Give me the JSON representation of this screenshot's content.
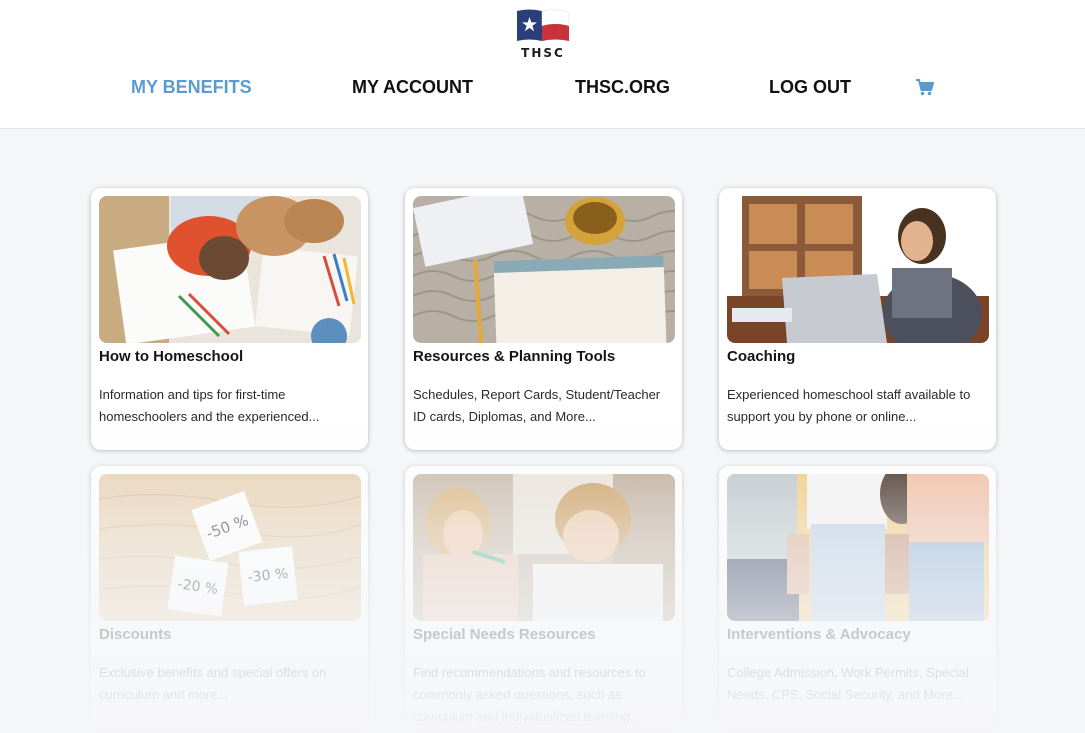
{
  "logo": {
    "text": "THSC",
    "icon": "texas-flag-icon"
  },
  "nav": {
    "items": [
      {
        "label": "MY BENEFITS",
        "active": true
      },
      {
        "label": "MY ACCOUNT",
        "active": false
      },
      {
        "label": "THSC.ORG",
        "active": false
      },
      {
        "label": "LOG OUT",
        "active": false
      }
    ],
    "cart_icon": "shopping-cart-icon"
  },
  "colors": {
    "accent": "#5b9bd0",
    "background": "#f5f6f8",
    "text": "#151515"
  },
  "cards": [
    {
      "title": "How to Homeschool",
      "description": "Information and tips for first-time homeschoolers and the experienced..."
    },
    {
      "title": "Resources & Planning Tools",
      "description": "Schedules, Report Cards, Student/Teacher ID cards, Diplomas, and More..."
    },
    {
      "title": "Coaching",
      "description": "Experienced homeschool staff available to support you by phone or online..."
    },
    {
      "title": "Discounts",
      "description": "Exclusive benefits and special offers on curriculum and more...",
      "image_text": [
        "-50 %",
        "-20 %",
        "-30 %"
      ]
    },
    {
      "title": "Special Needs Resources",
      "description": "Find recommendations and resources to commonly asked questions, such as curriculum and individualized learning..."
    },
    {
      "title": "Interventions & Advocacy",
      "description": "College Admission, Work Permits, Special Needs, CPS, Social Security, and More..."
    }
  ]
}
